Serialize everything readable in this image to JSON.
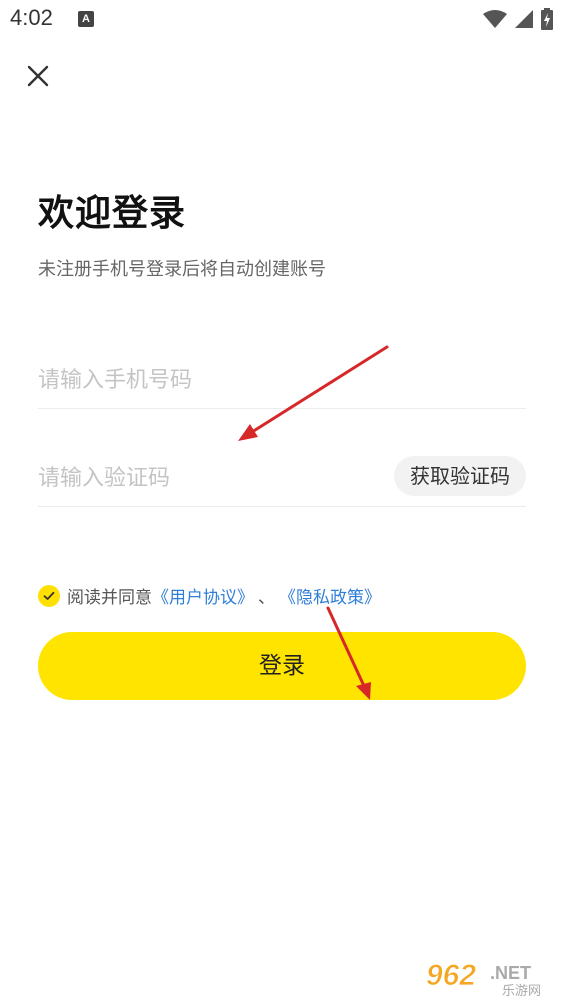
{
  "status_bar": {
    "time": "4:02",
    "notification_letter": "A",
    "icons": [
      "wifi-icon",
      "cell-signal-icon",
      "battery-charging-icon"
    ]
  },
  "header": {
    "close_icon": "close-icon"
  },
  "login": {
    "title": "欢迎登录",
    "subtitle": "未注册手机号登录后将自动创建账号",
    "phone_placeholder": "请输入手机号码",
    "phone_value": "",
    "code_placeholder": "请输入验证码",
    "code_value": "",
    "get_code_label": "获取验证码",
    "agree_prefix": "阅读并同意",
    "user_agreement": "《用户协议》",
    "separator": "、",
    "privacy_policy": "《隐私政策》",
    "agreed": true,
    "login_label": "登录"
  },
  "colors": {
    "accent": "#ffe400",
    "link": "#2f7fd8",
    "annotation_arrow": "#d62828"
  },
  "watermark": {
    "main": "962",
    "suffix": ".NET",
    "sub": "乐游网"
  }
}
